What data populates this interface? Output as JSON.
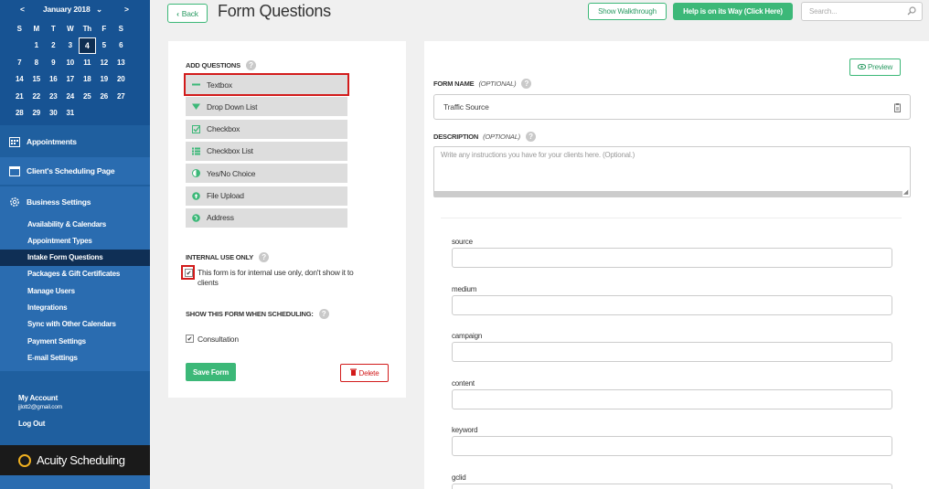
{
  "calendar": {
    "month_label": "January 2018",
    "prev": "<",
    "next": ">",
    "dropdown": "⌄",
    "day_headers": [
      "S",
      "M",
      "T",
      "W",
      "Th",
      "F",
      "S"
    ],
    "weeks": [
      [
        "",
        "1",
        "2",
        "3",
        "4",
        "5",
        "6"
      ],
      [
        "7",
        "8",
        "9",
        "10",
        "11",
        "12",
        "13"
      ],
      [
        "14",
        "15",
        "16",
        "17",
        "18",
        "19",
        "20"
      ],
      [
        "21",
        "22",
        "23",
        "24",
        "25",
        "26",
        "27"
      ],
      [
        "28",
        "29",
        "30",
        "31",
        "",
        "",
        ""
      ]
    ],
    "today": "4"
  },
  "sidebar": {
    "appointments": "Appointments",
    "clients_page": "Client's Scheduling Page",
    "business_settings": "Business Settings",
    "sub_items": [
      "Availability & Calendars",
      "Appointment Types",
      "Intake Form Questions",
      "Packages & Gift Certificates",
      "Manage Users",
      "Integrations",
      "Sync with Other Calendars",
      "Payment Settings",
      "E-mail Settings"
    ],
    "active_item": "Intake Form Questions",
    "my_account": "My Account",
    "email": "jjlott2@gmail.com",
    "logout": "Log Out",
    "logo_text": "Acuity Scheduling"
  },
  "header": {
    "back": "Back",
    "title": "Form Questions",
    "walkthrough": "Show Walkthrough",
    "help": "Help is on its Way (Click Here)",
    "search_placeholder": "Search..."
  },
  "add_questions": {
    "label": "ADD QUESTIONS",
    "items": [
      {
        "label": "Textbox",
        "icon": "minus-icon"
      },
      {
        "label": "Drop Down List",
        "icon": "triangle-down-icon"
      },
      {
        "label": "Checkbox",
        "icon": "check-square-icon"
      },
      {
        "label": "Checkbox List",
        "icon": "list-icon"
      },
      {
        "label": "Yes/No Choice",
        "icon": "half-circle-icon"
      },
      {
        "label": "File Upload",
        "icon": "upload-icon"
      },
      {
        "label": "Address",
        "icon": "globe-icon"
      }
    ]
  },
  "internal": {
    "label": "INTERNAL USE ONLY",
    "checkbox_text": "This form is for internal use only, don't show it to clients",
    "checked": true
  },
  "show_when": {
    "label": "SHOW THIS FORM WHEN SCHEDULING:",
    "option": "Consultation"
  },
  "actions": {
    "save": "Save Form",
    "delete": "Delete"
  },
  "form": {
    "preview": "Preview",
    "name_label": "FORM NAME",
    "name_optional": "(OPTIONAL)",
    "name_value": "Traffic Source",
    "desc_label": "DESCRIPTION",
    "desc_optional": "(OPTIONAL)",
    "desc_placeholder": "Write any instructions you have for your clients here. (Optional.)",
    "fields": [
      "source",
      "medium",
      "campaign",
      "content",
      "keyword",
      "gclid"
    ]
  },
  "colors": {
    "sidebar": "#1f5f9f",
    "accent_green": "#3cb878",
    "danger": "#d21b1b"
  }
}
